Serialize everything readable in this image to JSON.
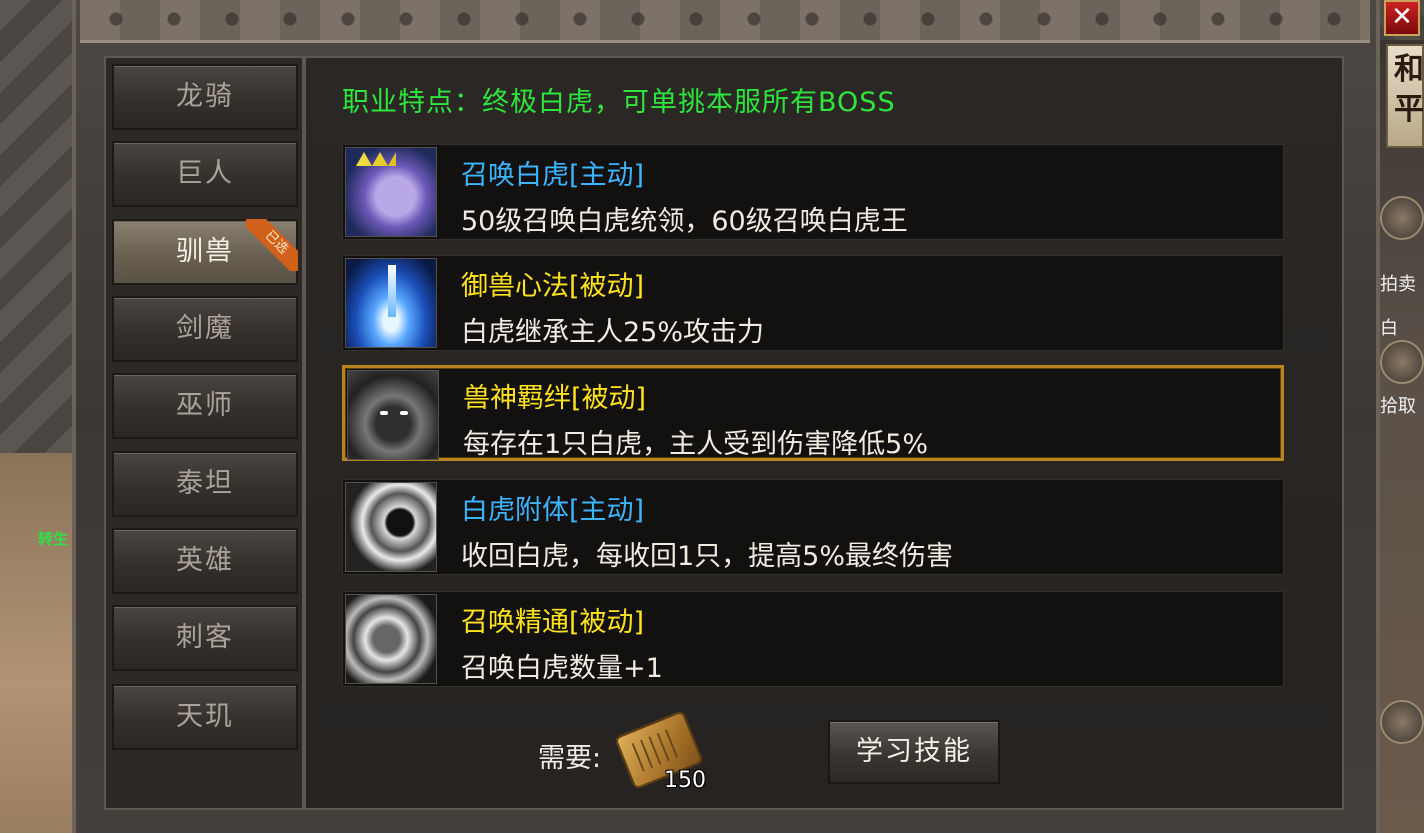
{
  "tabs": [
    {
      "label": "龙骑",
      "active": false
    },
    {
      "label": "巨人",
      "active": false
    },
    {
      "label": "驯兽",
      "active": true,
      "badge": "已选"
    },
    {
      "label": "剑魔",
      "active": false
    },
    {
      "label": "巫师",
      "active": false
    },
    {
      "label": "泰坦",
      "active": false
    },
    {
      "label": "英雄",
      "active": false
    },
    {
      "label": "刺客",
      "active": false
    },
    {
      "label": "天玑",
      "active": false
    }
  ],
  "trait": "职业特点：终极白虎，可单挑本服所有BOSS",
  "skills": [
    {
      "name": "召唤白虎[主动]",
      "type": "active",
      "desc": "50级召唤白虎统领，60级召唤白虎王",
      "icon": "white-tiger-icon"
    },
    {
      "name": "御兽心法[被动]",
      "type": "passive",
      "desc": "白虎继承主人25%攻击力",
      "icon": "blue-vortex-icon"
    },
    {
      "name": "兽神羁绊[被动]",
      "type": "passive",
      "desc": "每存在1只白虎，主人受到伤害降低5%",
      "icon": "dark-beast-icon",
      "selected": true
    },
    {
      "name": "白虎附体[主动]",
      "type": "active",
      "desc": "收回白虎，每收回1只，提高5%最终伤害",
      "icon": "claw-swirl-icon"
    },
    {
      "name": "召唤精通[被动]",
      "type": "passive",
      "desc": "召唤白虎数量+1",
      "icon": "summon-mastery-icon"
    }
  ],
  "requirement": {
    "label": "需要:",
    "count": "150",
    "icon": "skill-scroll-icon"
  },
  "learn_button": "学习技能",
  "close": "✕",
  "side": {
    "badge": "和平",
    "auction": "拍卖",
    "pickup": "拾取",
    "white": "白",
    "left_tag": "转生"
  },
  "colors": {
    "active_skill": "#3cb4ff",
    "passive_skill": "#ffe21e",
    "trait": "#2ee53b",
    "selected_border": "#b8841e"
  }
}
